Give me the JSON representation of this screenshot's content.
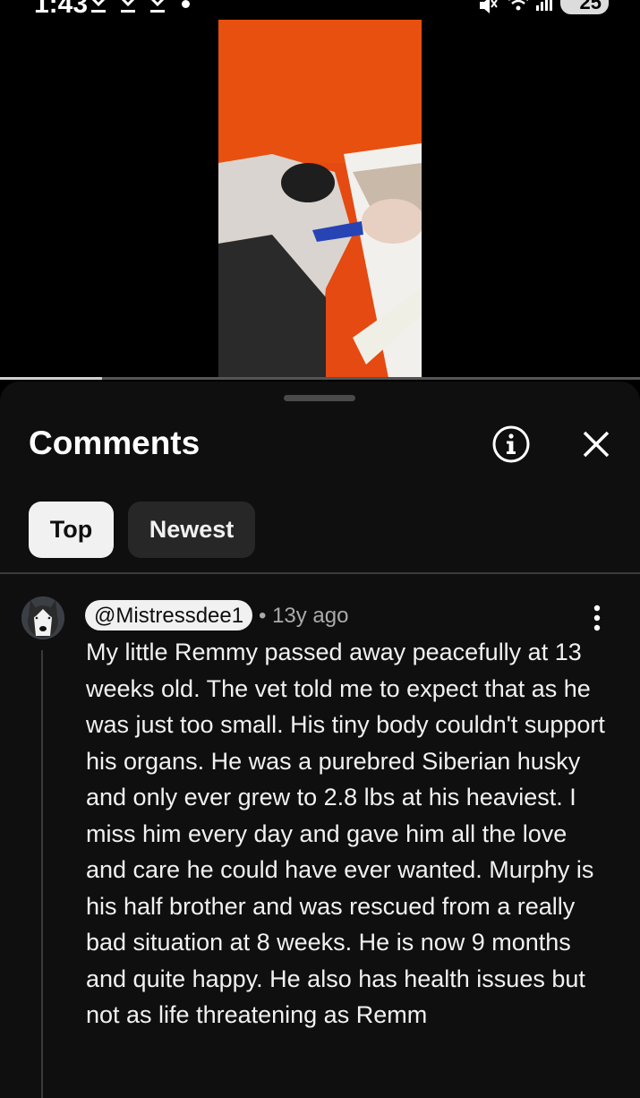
{
  "status_bar": {
    "time": "1:43",
    "battery": "25",
    "icons": [
      "download-icon",
      "download-icon",
      "download-icon",
      "notification-dot",
      "mute-icon",
      "wifi-icon",
      "signal-icon",
      "battery-icon"
    ]
  },
  "video": {
    "progress_fraction": 0.16
  },
  "comments_sheet": {
    "title": "Comments",
    "info_icon": "info-icon",
    "close_icon": "close-icon",
    "filters": [
      {
        "label": "Top",
        "selected": true
      },
      {
        "label": "Newest",
        "selected": false
      }
    ],
    "comment": {
      "author": "@Mistressdee1",
      "age": "• 13y ago",
      "text": "My little Remmy passed away peacefully at 13 weeks old. The vet told me to expect that as he was just too small. His tiny body couldn't support his organs. He was a purebred Siberian husky and only ever grew to 2.8 lbs at his heaviest. I miss him every day and gave him all the love and care he could have ever wanted. Murphy is his half brother and was rescued from a really bad situation at 8 weeks. He is now 9 months and quite happy. He also has health issues but not as life threatening as Remm",
      "menu_icon": "more-vert-icon"
    }
  },
  "colors": {
    "sheet_bg": "#0f0f0f",
    "chip_selected": "#f1f1f1",
    "chip_unselected": "#272727",
    "video_bg": "#e44a12"
  }
}
